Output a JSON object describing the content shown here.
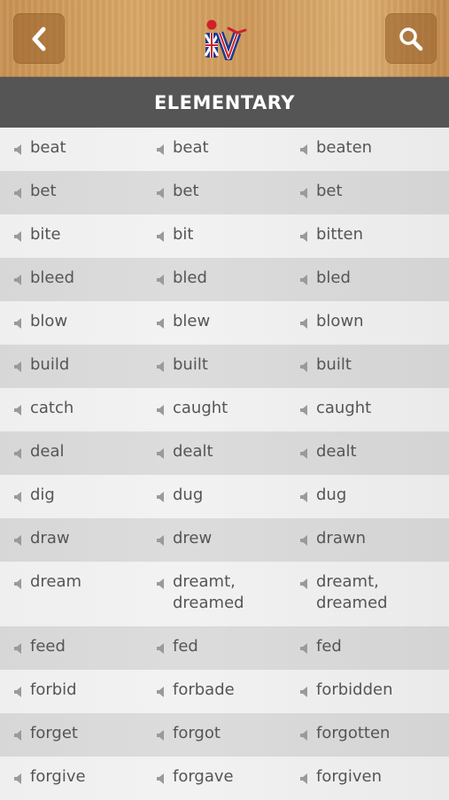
{
  "header": {
    "back_icon": "chevron-left-icon",
    "search_icon": "search-icon",
    "logo": {
      "text": "iv",
      "colors": {
        "red": "#d0202a",
        "blue": "#1e3a8a",
        "white": "#ffffff"
      }
    },
    "section_title": "ELEMENTARY"
  },
  "verbs": [
    {
      "base": "beat",
      "past": "beat",
      "participle": "beaten"
    },
    {
      "base": "bet",
      "past": "bet",
      "participle": "bet"
    },
    {
      "base": "bite",
      "past": "bit",
      "participle": "bitten"
    },
    {
      "base": "bleed",
      "past": "bled",
      "participle": "bled"
    },
    {
      "base": "blow",
      "past": "blew",
      "participle": "blown"
    },
    {
      "base": "build",
      "past": "built",
      "participle": "built"
    },
    {
      "base": "catch",
      "past": "caught",
      "participle": "caught"
    },
    {
      "base": "deal",
      "past": "dealt",
      "participle": "dealt"
    },
    {
      "base": "dig",
      "past": "dug",
      "participle": "dug"
    },
    {
      "base": "draw",
      "past": "drew",
      "participle": "drawn"
    },
    {
      "base": "dream",
      "past": [
        "dreamt,",
        "dreamed"
      ],
      "participle": [
        "dreamt,",
        "dreamed"
      ]
    },
    {
      "base": "feed",
      "past": "fed",
      "participle": "fed"
    },
    {
      "base": "forbid",
      "past": "forbade",
      "participle": "forbidden"
    },
    {
      "base": "forget",
      "past": "forgot",
      "participle": "forgotten"
    },
    {
      "base": "forgive",
      "past": "forgave",
      "participle": "forgiven"
    }
  ],
  "icons": {
    "speaker": "speaker-icon"
  }
}
